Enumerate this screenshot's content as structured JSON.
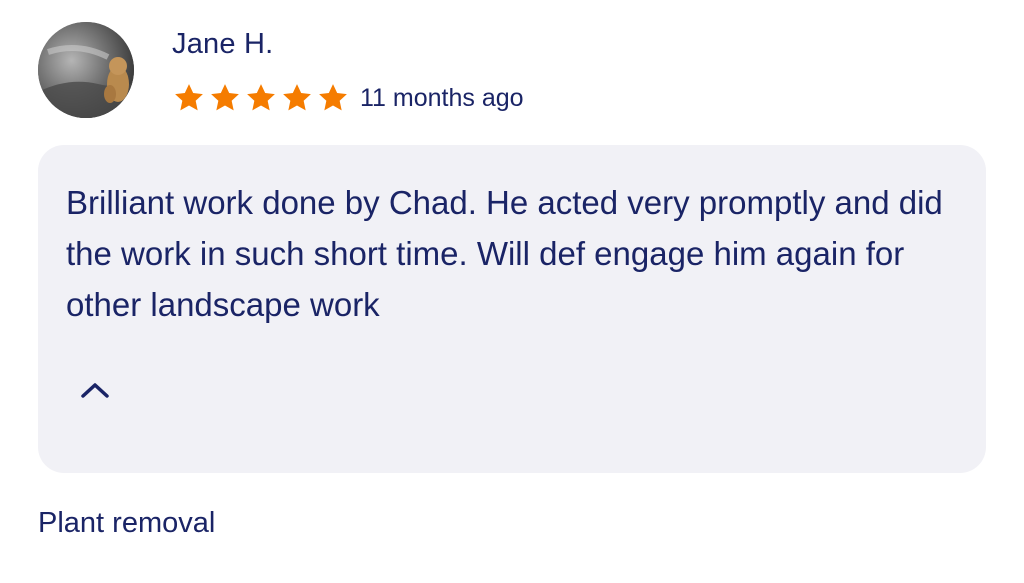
{
  "review": {
    "reviewer_name": "Jane H.",
    "avatar_icon": "avatar-photo",
    "rating": 5,
    "rating_max": 5,
    "star_color": "#f57c00",
    "time_ago": "11 months ago",
    "text": "Brilliant work done by Chad. He acted very promptly and did the work in such short time. Will def engage him again for other landscape work",
    "collapse_icon": "chevron-up-icon",
    "service": "Plant removal"
  },
  "colors": {
    "text": "#1a2466",
    "box_background": "#f1f1f6",
    "page_background": "#ffffff"
  }
}
